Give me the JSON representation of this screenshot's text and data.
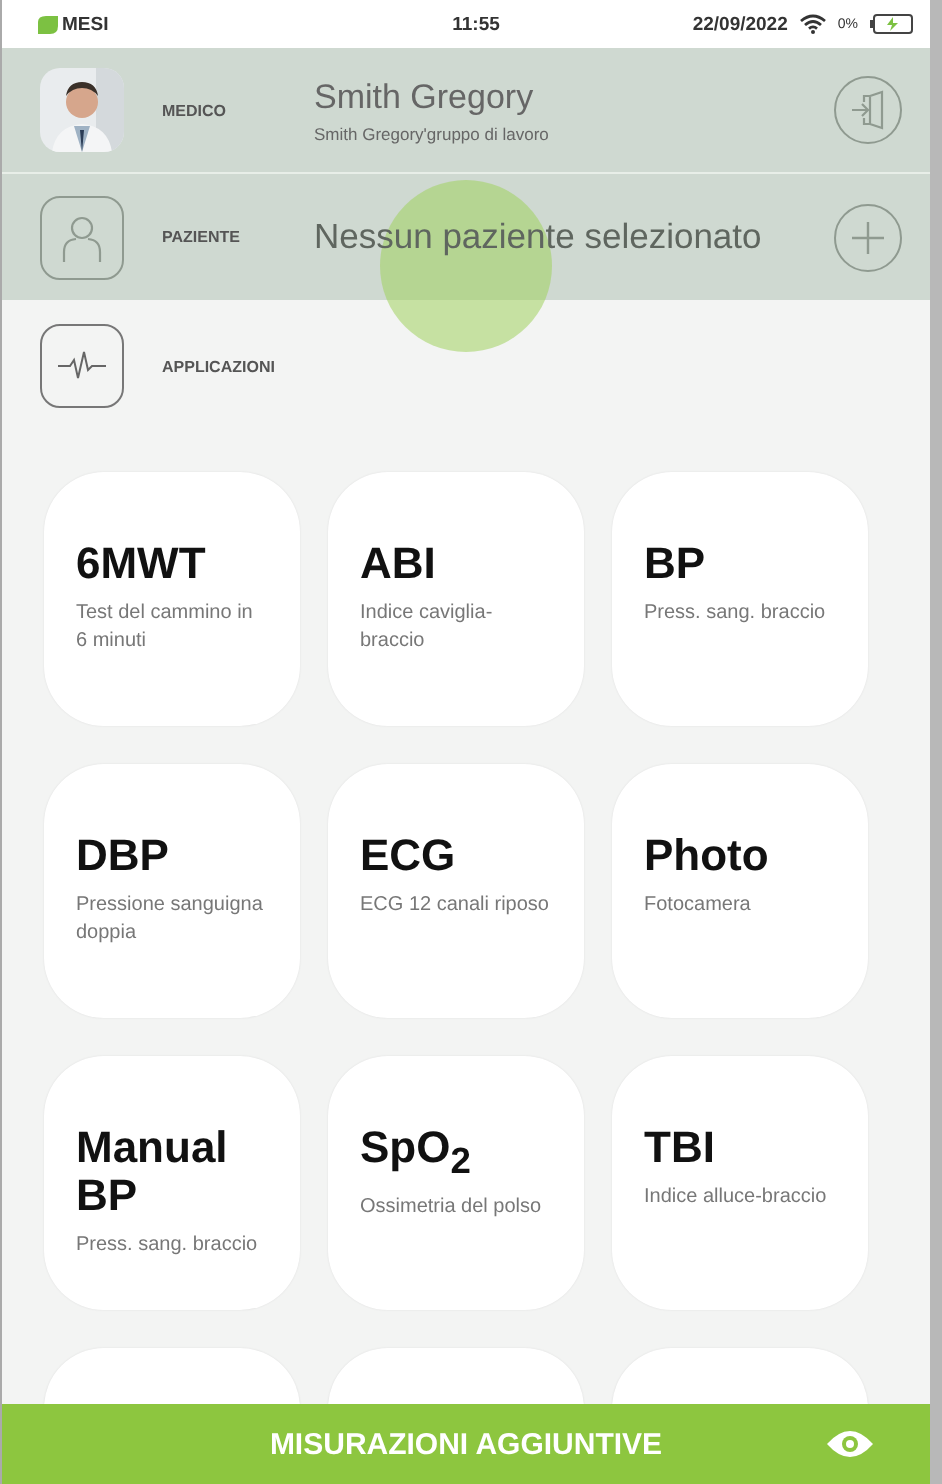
{
  "status_bar": {
    "brand": "MESI",
    "time": "11:55",
    "date": "22/09/2022",
    "battery": "0%",
    "charging": true
  },
  "doctor": {
    "label": "MEDICO",
    "name": "Smith Gregory",
    "group": "Smith Gregory'gruppo di lavoro"
  },
  "patient": {
    "label": "PAZIENTE",
    "placeholder": "Nessun paziente selezionato"
  },
  "applications": {
    "label": "APPLICAZIONI"
  },
  "touch_indicator": true,
  "tiles": [
    {
      "kind": "app",
      "title": "6MWT",
      "subtitle": "Test del cammino in 6 minuti"
    },
    {
      "kind": "app",
      "title": "ABI",
      "subtitle": "Indice caviglia-braccio"
    },
    {
      "kind": "app",
      "title": "BP",
      "subtitle": "Press. sang. braccio"
    },
    {
      "kind": "app",
      "title": "DBP",
      "subtitle": "Pressione sanguigna doppia"
    },
    {
      "kind": "app",
      "title": "ECG",
      "subtitle": "ECG 12 canali riposo"
    },
    {
      "kind": "app",
      "title": "Photo",
      "subtitle": "Fotocamera"
    },
    {
      "kind": "app",
      "title": "Manual BP",
      "subtitle": "Press. sang. braccio"
    },
    {
      "kind": "app",
      "title": "SpO$_{2}$",
      "subtitle": "Ossimetria del polso"
    },
    {
      "kind": "app",
      "title": "TBI",
      "subtitle": "Indice alluce-braccio"
    },
    {
      "kind": "blank"
    },
    {
      "kind": "blank"
    },
    {
      "kind": "blank"
    }
  ],
  "bottom_bar": {
    "label": "MISURAZIONI AGGIUNTIVE"
  }
}
